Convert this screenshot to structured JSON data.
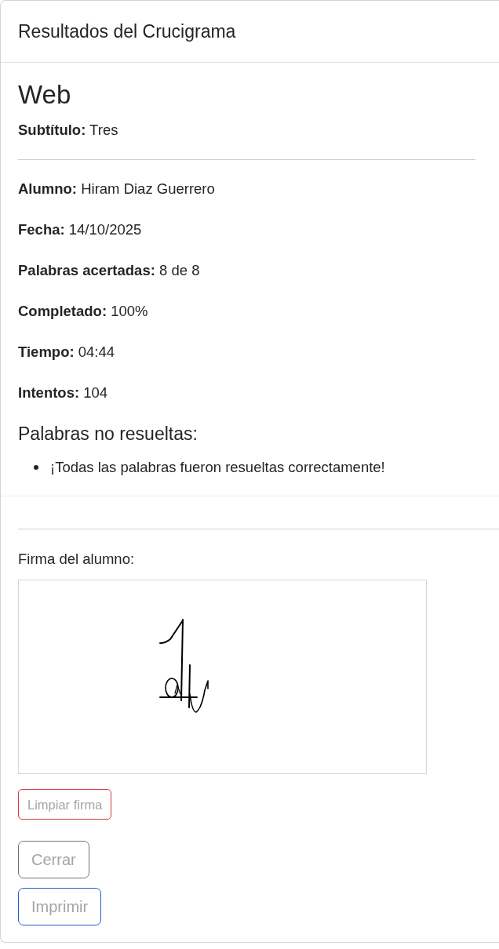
{
  "card": {
    "title": "Resultados del Crucigrama"
  },
  "crossword": {
    "name": "Web",
    "subtitle": "**Subtítulo:** Tres"
  },
  "details": [
    "**Alumno:** Hiram Diaz Guerrero",
    "**Fecha:** 14/10/2025",
    "**Palabras acertadas:** 8 de 8",
    "**Completado:** 100%",
    "**Tiempo:** 04:44",
    "**Intentos:** 104"
  ],
  "unsolved": {
    "heading": "Palabras no resueltas:",
    "items": [
      "¡Todas las palabras fueron resueltas correctamente!"
    ]
  },
  "signature": {
    "label": "Firma del alumno:",
    "clear_button": {
      "label": "Limpiar firma",
      "kind": "danger",
      "disabled": true
    }
  },
  "actions": [
    {
      "label": "Cerrar",
      "kind": "secondary",
      "disabled": true
    },
    {
      "label": "Imprimir",
      "kind": "primary",
      "disabled": true
    }
  ]
}
